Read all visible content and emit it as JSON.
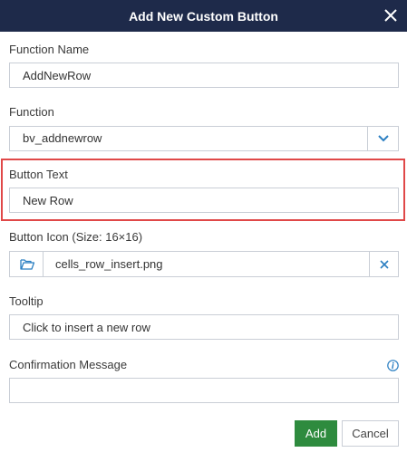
{
  "dialog": {
    "title": "Add New Custom Button",
    "close_icon": "close-icon"
  },
  "fields": {
    "function_name": {
      "label": "Function Name",
      "value": "AddNewRow"
    },
    "function": {
      "label": "Function",
      "value": "bv_addnewrow",
      "icon": "chevron-down-icon"
    },
    "button_text": {
      "label": "Button Text",
      "value": "New Row"
    },
    "button_icon": {
      "label": "Button Icon (Size: 16×16)",
      "value": "cells_row_insert.png",
      "browse_icon": "folder-open-icon",
      "clear_icon": "clear-icon"
    },
    "tooltip": {
      "label": "Tooltip",
      "value": "Click to insert a new row"
    },
    "confirmation_message": {
      "label": "Confirmation Message",
      "value": "",
      "info_icon": "info-icon"
    }
  },
  "actions": {
    "add_label": "Add",
    "cancel_label": "Cancel"
  },
  "colors": {
    "titlebar": "#1e2a4a",
    "primary": "#2e8b3e",
    "highlight": "#e04848",
    "accent_icon": "#2b7fc2"
  }
}
